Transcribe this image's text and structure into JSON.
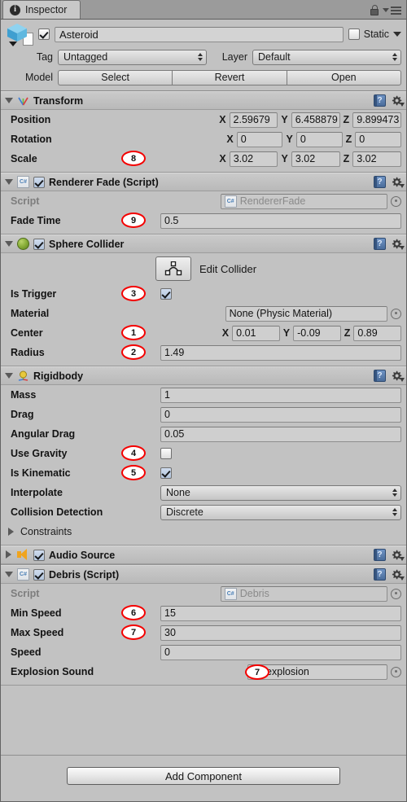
{
  "window": {
    "tab_title": "Inspector",
    "tab_icon": "info-icon",
    "lock_icon": "lock-icon",
    "menu_icon": "hamburger-menu-icon"
  },
  "gameobject": {
    "prefab_icon": "prefab-cube-icon",
    "enabled": true,
    "name": "Asteroid",
    "static_checked": false,
    "static_label": "Static",
    "static_dropdown_icon": "chevron-down-icon",
    "tag_label": "Tag",
    "tag_value": "Untagged",
    "layer_label": "Layer",
    "layer_value": "Default",
    "model_label": "Model",
    "model_buttons": [
      "Select",
      "Revert",
      "Open"
    ]
  },
  "components": [
    {
      "name": "Transform",
      "icon": "transform-gizmo-icon",
      "expanded": true,
      "has_enable_checkbox": false,
      "help_icon": "help-book-icon",
      "gear_icon": "gear-icon",
      "rows": [
        {
          "type": "vector3",
          "label": "Position",
          "x": "2.59679",
          "y": "6.458879",
          "z": "9.899473"
        },
        {
          "type": "vector3",
          "label": "Rotation",
          "x": "0",
          "y": "0",
          "z": "0"
        },
        {
          "type": "vector3",
          "label": "Scale",
          "badge": "8",
          "x": "3.02",
          "y": "3.02",
          "z": "3.02"
        }
      ]
    },
    {
      "name": "Renderer Fade (Script)",
      "icon": "csharp-script-icon",
      "expanded": true,
      "has_enable_checkbox": true,
      "enabled": true,
      "help_icon": "help-book-icon",
      "gear_icon": "gear-icon",
      "rows": [
        {
          "type": "objref",
          "label": "Script",
          "value": "RendererFade",
          "dim": true,
          "value_icon": "csharp-script-icon"
        },
        {
          "type": "text",
          "label": "Fade Time",
          "badge": "9",
          "value": "0.5"
        }
      ]
    },
    {
      "name": "Sphere Collider",
      "icon": "sphere-collider-icon",
      "expanded": true,
      "has_enable_checkbox": true,
      "enabled": true,
      "help_icon": "help-book-icon",
      "gear_icon": "gear-icon",
      "edit_collider": {
        "label": "Edit Collider",
        "icon": "edit-collider-icon"
      },
      "rows": [
        {
          "type": "checkbox",
          "label": "Is Trigger",
          "badge": "3",
          "checked": true
        },
        {
          "type": "objref",
          "label": "Material",
          "value": "None (Physic Material)"
        },
        {
          "type": "vector3",
          "label": "Center",
          "badge": "1",
          "x": "0.01",
          "y": "-0.09",
          "z": "0.89"
        },
        {
          "type": "text",
          "label": "Radius",
          "badge": "2",
          "value": "1.49"
        }
      ]
    },
    {
      "name": "Rigidbody",
      "icon": "rigidbody-icon",
      "expanded": true,
      "has_enable_checkbox": false,
      "help_icon": "help-book-icon",
      "gear_icon": "gear-icon",
      "rows": [
        {
          "type": "text",
          "label": "Mass",
          "value": "1"
        },
        {
          "type": "text",
          "label": "Drag",
          "value": "0"
        },
        {
          "type": "text",
          "label": "Angular Drag",
          "value": "0.05"
        },
        {
          "type": "checkbox",
          "label": "Use Gravity",
          "badge": "4",
          "checked": false
        },
        {
          "type": "checkbox",
          "label": "Is Kinematic",
          "badge": "5",
          "checked": true
        },
        {
          "type": "popup",
          "label": "Interpolate",
          "value": "None"
        },
        {
          "type": "popup",
          "label": "Collision Detection",
          "value": "Discrete"
        },
        {
          "type": "foldout",
          "label": "Constraints",
          "expanded": false
        }
      ]
    },
    {
      "name": "Audio Source",
      "icon": "audio-source-icon",
      "expanded": false,
      "has_enable_checkbox": true,
      "enabled": true,
      "help_icon": "help-book-icon",
      "gear_icon": "gear-icon",
      "rows": []
    },
    {
      "name": "Debris (Script)",
      "icon": "csharp-script-icon",
      "expanded": true,
      "has_enable_checkbox": true,
      "enabled": true,
      "help_icon": "help-book-icon",
      "gear_icon": "gear-icon",
      "rows": [
        {
          "type": "objref",
          "label": "Script",
          "value": "Debris",
          "dim": true,
          "value_icon": "csharp-script-icon"
        },
        {
          "type": "text",
          "label": "Min Speed",
          "badge": "6",
          "value": "15"
        },
        {
          "type": "text",
          "label": "Max Speed",
          "badge": "7",
          "value": "30"
        },
        {
          "type": "text",
          "label": "Speed",
          "value": "0"
        },
        {
          "type": "objref",
          "label": "Explosion Sound",
          "value": "explosion",
          "value_icon": "audio-clip-icon",
          "badge_inline": "7"
        }
      ]
    }
  ],
  "footer": {
    "add_component_label": "Add Component"
  },
  "colors": {
    "panel_bg": "#c2c2c2",
    "header_bg": "#c3c3c3",
    "field_bg": "#cfcfcf",
    "badge_ring": "#f40000",
    "accent_blue": "#4a6c9b"
  }
}
